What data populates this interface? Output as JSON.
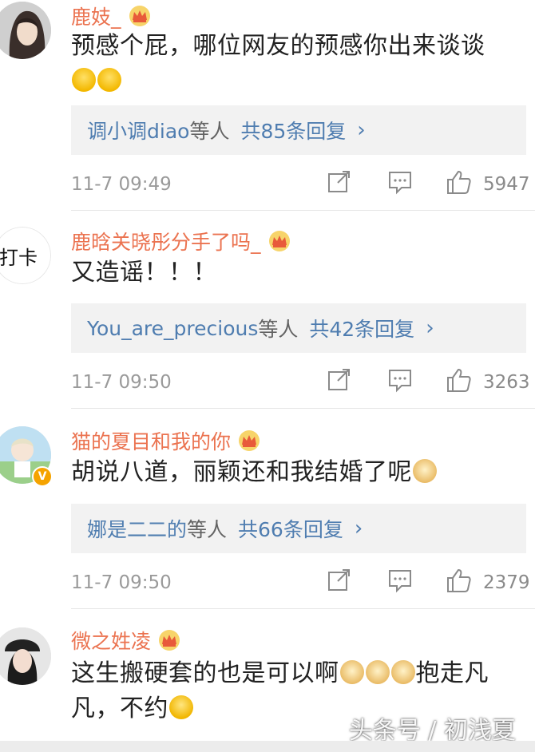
{
  "comments": [
    {
      "username": "鹿妓_",
      "text": "预感个屁，哪位网友的预感你出来谈谈",
      "emoji_names": [
        "laugh-cry-emoji",
        "laugh-cry-emoji"
      ],
      "reply_users": "调小调diao",
      "reply_suffix": "等人",
      "reply_total": "共85条回复",
      "time": "11-7 09:49",
      "likes": "5947"
    },
    {
      "username": "鹿晗关晓彤分手了吗_",
      "avatar_text": "打卡",
      "text": "又造谣！！！",
      "reply_users": "You_are_precious",
      "reply_suffix": "等人",
      "reply_total": "共42条回复",
      "time": "11-7 09:50",
      "likes": "3263"
    },
    {
      "username": "猫的夏目和我的你",
      "text": "胡说八道，丽颖还和我结婚了呢",
      "emoji_names": [
        "doge-emoji"
      ],
      "reply_users": "娜是二二的",
      "reply_suffix": "等人",
      "reply_total": "共66条回复",
      "time": "11-7 09:50",
      "likes": "2379"
    },
    {
      "username": "微之姓凌",
      "text_part1": "这生搬硬套的也是可以啊",
      "text_part2": "抱走凡",
      "text_line2": "凡，不约",
      "emoji_names": [
        "doge-emoji",
        "doge-emoji",
        "doge-emoji",
        "thinking-emoji"
      ]
    }
  ],
  "icons": {
    "repost": "repost-icon",
    "comment": "comment-icon",
    "like": "thumbs-up-icon",
    "member": "crown-icon",
    "verified": "verified-v-badge",
    "chevron": "›"
  },
  "verified_badge": "V",
  "watermark": "头条号 / 初浅夏",
  "colors": {
    "username": "#eb7350",
    "link": "#4f7db0",
    "meta": "#9a9a9a",
    "reply_bg": "#f2f2f2"
  }
}
